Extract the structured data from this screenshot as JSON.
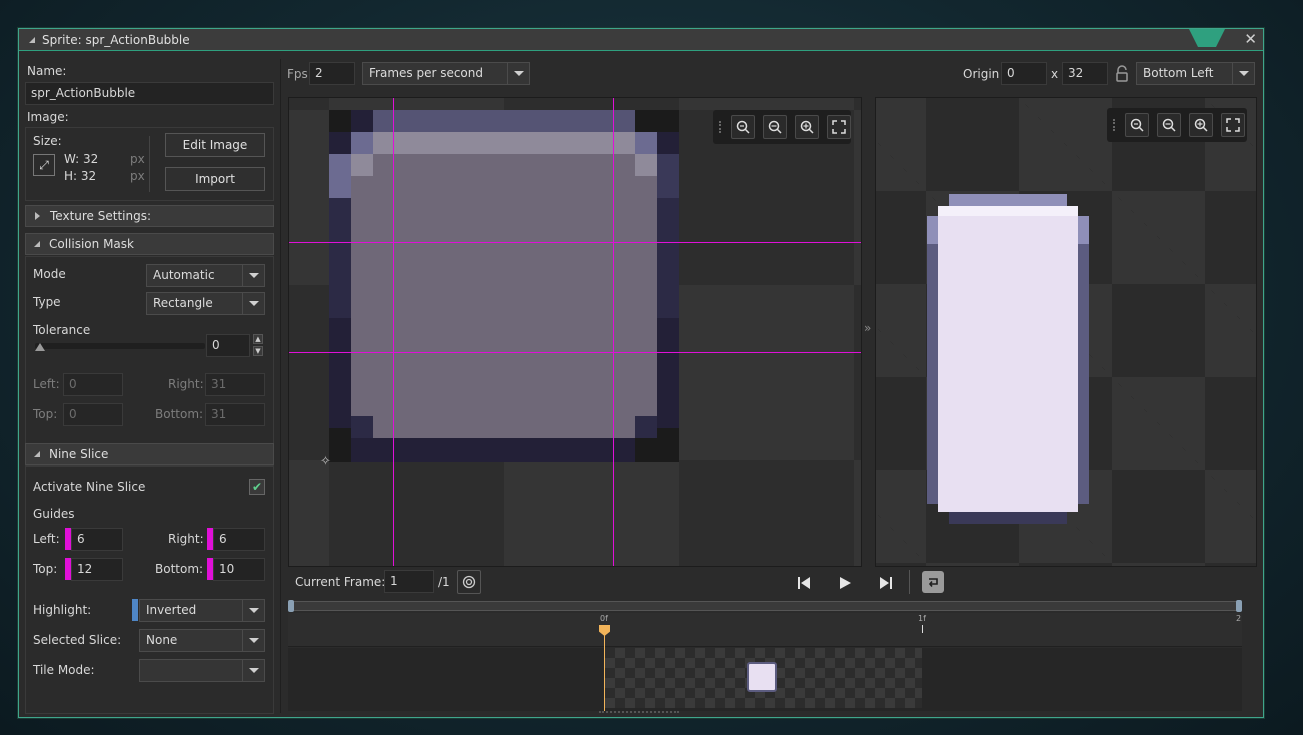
{
  "window": {
    "title": "Sprite: spr_ActionBubble",
    "accent": "#2fa07f"
  },
  "left": {
    "name_label": "Name:",
    "name_value": "spr_ActionBubble",
    "image_label": "Image:",
    "size_label": "Size:",
    "width": "W: 32",
    "height": "H: 32",
    "px": "px",
    "edit_image": "Edit Image",
    "import": "Import",
    "texture_settings": "Texture Settings:",
    "collision_mask": "Collision Mask",
    "mode_label": "Mode",
    "mode_value": "Automatic",
    "type_label": "Type",
    "type_value": "Rectangle",
    "tolerance_label": "Tolerance",
    "tolerance_value": "0",
    "tolerance_level": 0,
    "left_label": "Left:",
    "left_value": "0",
    "right_label": "Right:",
    "right_value": "31",
    "top_label": "Top:",
    "top_value": "0",
    "bottom_label": "Bottom:",
    "bottom_value": "31",
    "nine_slice": "Nine Slice",
    "activate_label": "Activate Nine Slice",
    "activate_checked": true,
    "guides_label": "Guides",
    "g_left_label": "Left:",
    "g_left_value": "6",
    "g_right_label": "Right:",
    "g_right_value": "6",
    "g_top_label": "Top:",
    "g_top_value": "12",
    "g_bottom_label": "Bottom:",
    "g_bottom_value": "10",
    "highlight_label": "Highlight:",
    "highlight_value": "Inverted",
    "selected_slice_label": "Selected Slice:",
    "selected_slice_value": "None",
    "tile_mode_label": "Tile Mode:",
    "tile_mode_value": ""
  },
  "top": {
    "fps_label": "Fps",
    "fps_value": "2",
    "fps_mode": "Frames per second",
    "origin_label": "Origin",
    "origin_x": "0",
    "origin_x_sep": "x",
    "origin_y": "32",
    "origin_preset": "Bottom Left"
  },
  "timeline": {
    "current_frame_label": "Current Frame:",
    "current_frame_value": "1",
    "frame_total": "/1",
    "marker_0": "0f",
    "marker_1": "1f",
    "marker_2": "2"
  },
  "colors": {
    "guide": "#e010d8",
    "sprite_fill": "#6f6878",
    "sprite_border": "#22203a",
    "preview_fill": "#e8e0f2"
  }
}
